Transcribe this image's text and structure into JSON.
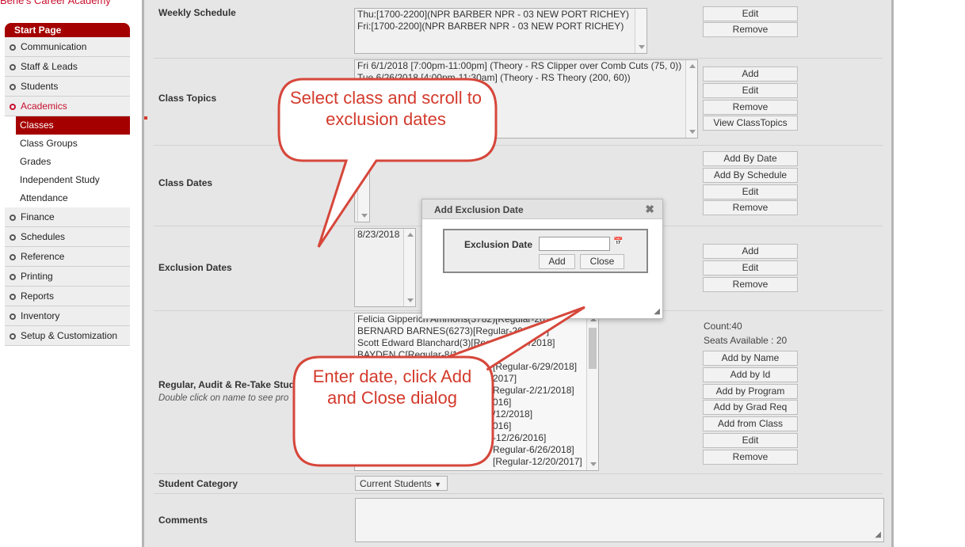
{
  "brand": "Bene's Career Academy",
  "sidebar": {
    "start": "Start Page",
    "items_top": [
      "Communication",
      "Staff & Leads",
      "Students"
    ],
    "academics": "Academics",
    "sub": [
      "Classes",
      "Class Groups",
      "Grades",
      "Independent Study",
      "Attendance"
    ],
    "items_bottom": [
      "Finance",
      "Schedules",
      "Reference",
      "Printing",
      "Reports",
      "Inventory",
      "Setup & Customization"
    ]
  },
  "sections": {
    "weekly": {
      "label": "Weekly Schedule",
      "rows": [
        "Thu:[1700-2200](NPR BARBER NPR - 03 NEW PORT RICHEY)",
        "Fri:[1700-2200](NPR BARBER NPR - 03 NEW PORT RICHEY)"
      ],
      "buttons": [
        "Edit",
        "Remove"
      ]
    },
    "topics": {
      "label": "Class Topics",
      "rows": [
        "Fri 6/1/2018 [7:00pm-11:00pm] (Theory - RS Clipper over Comb Cuts (75, 0))",
        "Tue 6/26/2018 [4:00pm-11:30am] (Theory - RS Theory (200, 60))"
      ],
      "buttons": [
        "Add",
        "Edit",
        "Remove",
        "View ClassTopics"
      ]
    },
    "dates": {
      "label": "Class Dates",
      "buttons": [
        "Add By Date",
        "Add By Schedule",
        "Edit",
        "Remove"
      ]
    },
    "exclusion": {
      "label": "Exclusion Dates",
      "rows": [
        "8/23/2018"
      ],
      "buttons": [
        "Add",
        "Edit",
        "Remove"
      ]
    },
    "students": {
      "label": "Regular, Audit & Re-Take Stud",
      "sublabel": "Double click on name to see pro",
      "rows": [
        "Felicia Gipperich Ammons(3782)[Regular-2017]",
        "BERNARD BARNES(6273)[Regular-20/2017]",
        "Scott Edward Blanchard(3)[Regular-5/29/2018]",
        "BAYDEN C[Regular-8/1/2017]",
        "[Regular-6/29/2018]",
        "2017]",
        "Regular-2/21/2018]",
        "016]",
        "/12/2018]",
        "016]",
        "-12/26/2016]",
        "Regular-6/26/2018]",
        "[Regular-12/20/2017]"
      ],
      "count": "Count:40",
      "seats": "Seats Available : 20",
      "buttons": [
        "Add by Name",
        "Add by Id",
        "Add by Program",
        "Add by Grad Req",
        "Add from Class",
        "Edit",
        "Remove"
      ]
    },
    "category": {
      "label": "Student Category",
      "value": "Current Students"
    },
    "comments": {
      "label": "Comments"
    }
  },
  "dialog": {
    "title": "Add Exclusion Date",
    "field_label": "Exclusion Date",
    "value": "",
    "add": "Add",
    "close": "Close"
  },
  "callouts": {
    "top": "Select class and scroll to exclusion dates",
    "bottom": "Enter date, click Add and Close dialog"
  }
}
